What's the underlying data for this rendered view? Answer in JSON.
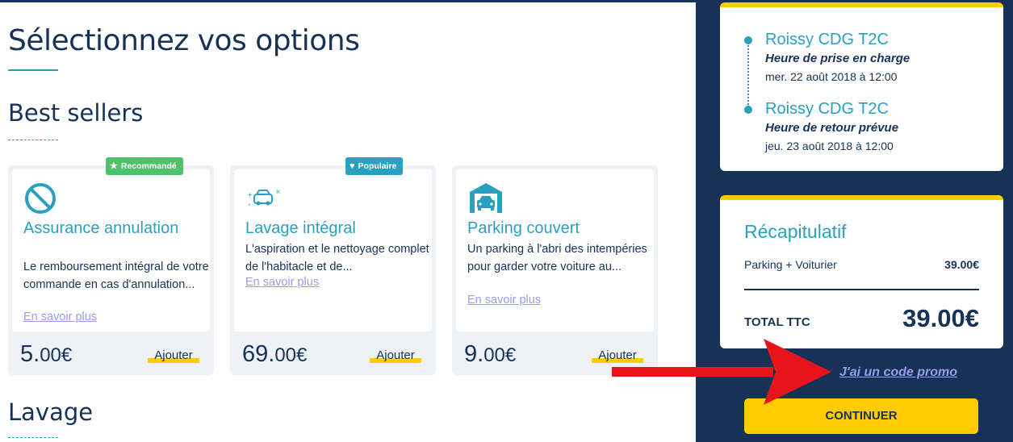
{
  "page_title": "Sélectionnez vos options",
  "sections": {
    "best_sellers": "Best sellers",
    "lavage": "Lavage"
  },
  "cards": [
    {
      "badge": "Recommandé",
      "badge_color": "#4fc06c",
      "icon": "cancel-circle-icon",
      "title": "Assurance annulation",
      "description": "Le remboursement intégral de votre commande en cas d'annulation...",
      "link": "En savoir plus",
      "price_int": "5.",
      "price_dec": "00€",
      "add_label": "Ajouter"
    },
    {
      "badge": "Populaire",
      "badge_color": "#2aa0c1",
      "icon": "car-wash-icon",
      "title": "Lavage intégral",
      "description": "L'aspiration et le nettoyage complet de l'habitacle et de...",
      "link": "En savoir plus",
      "price_int": "69.",
      "price_dec": "00€",
      "add_label": "Ajouter"
    },
    {
      "badge": "",
      "icon": "garage-car-icon",
      "title": "Parking couvert",
      "description": "Un parking à l'abri des intempéries pour garder votre voiture au...",
      "link": "En savoir plus",
      "price_int": "9.",
      "price_dec": "00€",
      "add_label": "Ajouter"
    }
  ],
  "trip": {
    "pickup": {
      "place": "Roissy CDG T2C",
      "label": "Heure de prise en charge",
      "datetime": "mer. 22 août 2018 à 12:00"
    },
    "return": {
      "place": "Roissy CDG T2C",
      "label": "Heure de retour prévue",
      "datetime": "jeu. 23 août 2018 à 12:00"
    }
  },
  "recap": {
    "title": "Récapitulatif",
    "line_label": "Parking + Voiturier",
    "line_value": "39.00€",
    "total_label": "TOTAL TTC",
    "total_value": "39.00€"
  },
  "promo_link": "J'ai un code promo",
  "continue_label": "CONTINUER",
  "colors": {
    "navy": "#163257",
    "teal": "#2aa0c1",
    "yellow": "#ffcc00",
    "link": "#9a9cea",
    "arrow": "#e8141c"
  }
}
